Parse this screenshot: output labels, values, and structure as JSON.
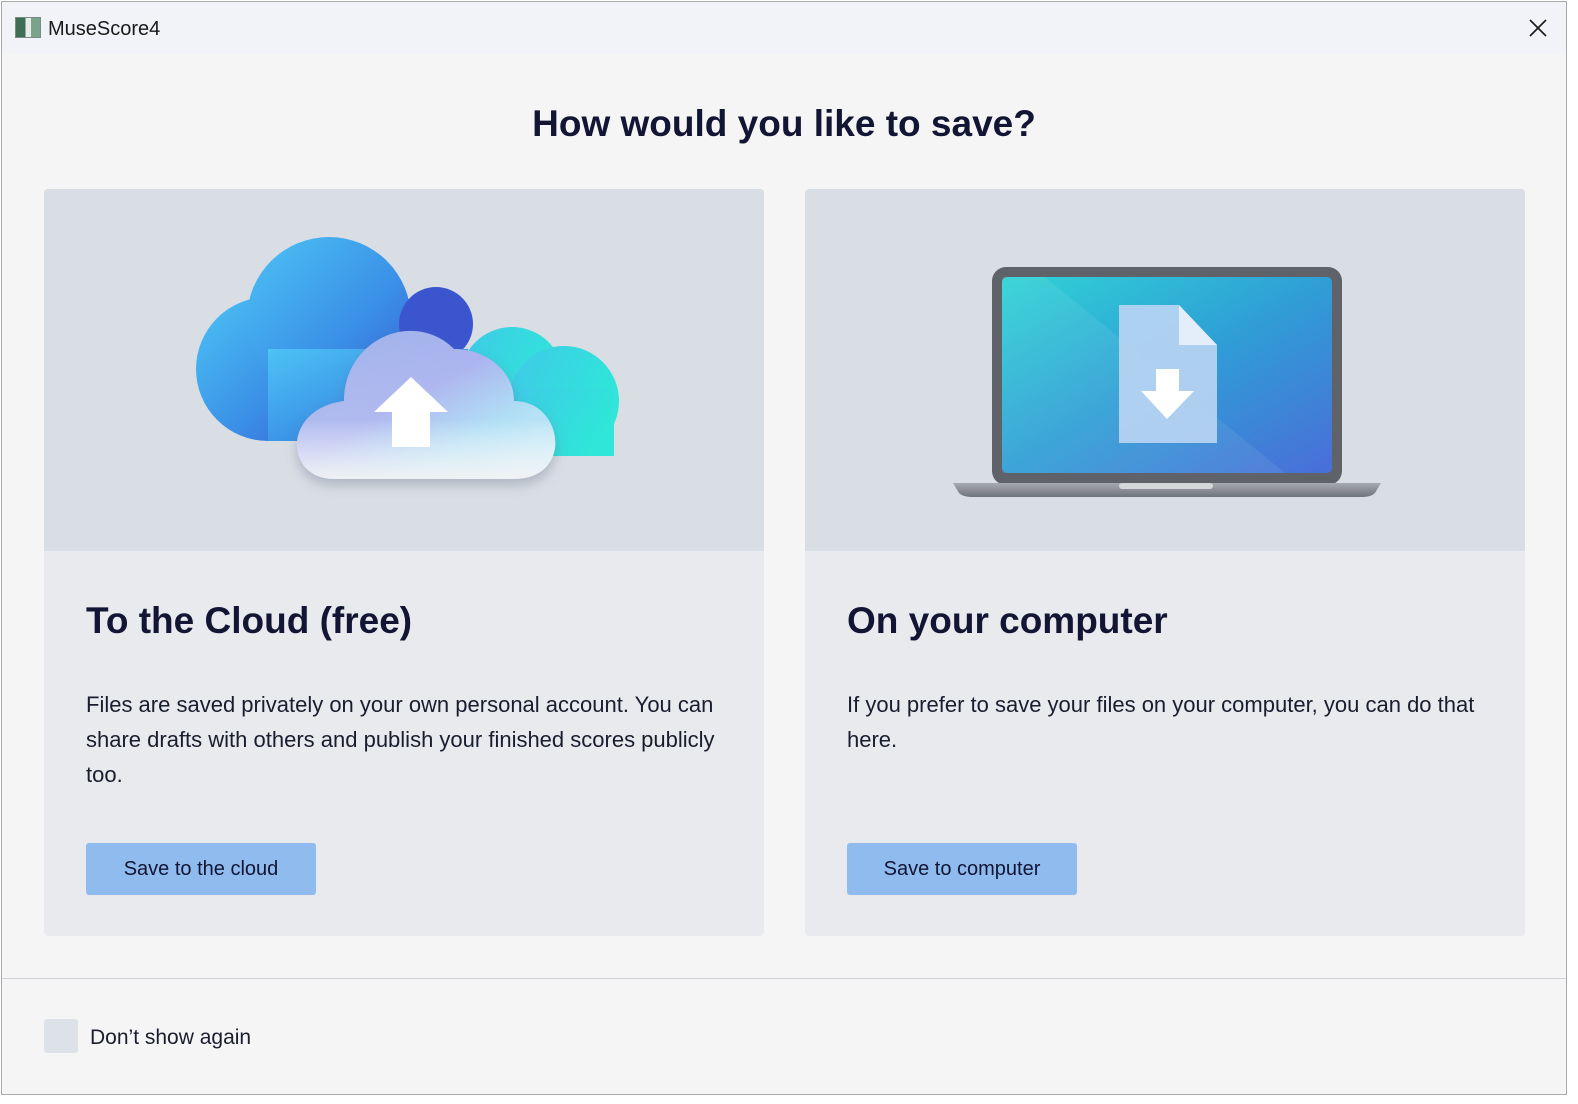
{
  "window": {
    "title": "MuseScore4",
    "close_icon": "close-icon"
  },
  "dialog": {
    "heading": "How would you like to save?"
  },
  "options": {
    "cloud": {
      "title": "To the Cloud (free)",
      "description": "Files are saved privately on your own personal account. You can share drafts with others and publish your finished scores publicly too.",
      "button_label": "Save to the cloud",
      "illustration": "cloud-upload-illustration"
    },
    "computer": {
      "title": "On your computer",
      "description": "If you prefer to save your files on your computer, you can do that here.",
      "button_label": "Save to computer",
      "illustration": "laptop-download-illustration"
    }
  },
  "footer": {
    "dont_show_again_label": "Don’t show again",
    "dont_show_again_checked": false
  },
  "colors": {
    "accent_button": "#8fbbee",
    "card_background": "#e8eaee",
    "illustration_background": "#d9dee5",
    "heading_text": "#121533"
  }
}
